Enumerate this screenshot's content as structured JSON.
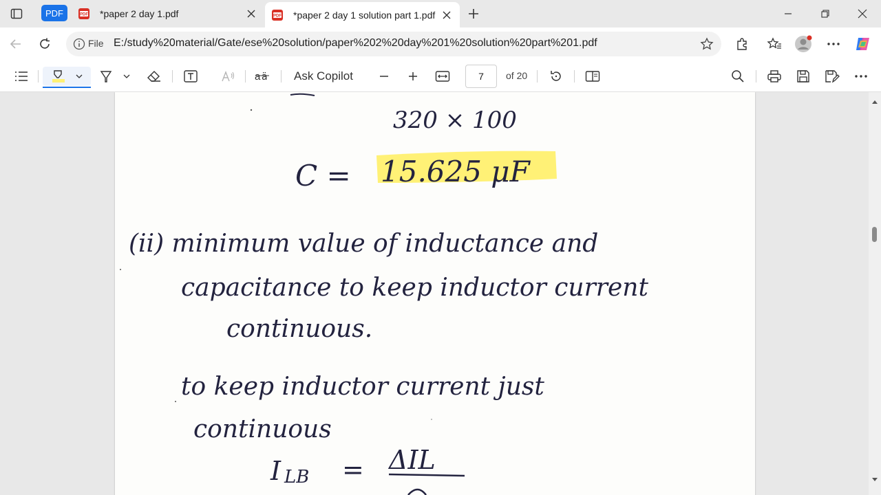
{
  "tabs": {
    "group_label": "PDF",
    "inactive_title": "*paper 2 day 1.pdf",
    "active_title": "*paper 2 day 1 solution part 1.pdf"
  },
  "address": {
    "scheme_label": "File",
    "url": "E:/study%20material/Gate/ese%20solution/paper%202%20day%201%20solution%20part%201.pdf"
  },
  "pdf_toolbar": {
    "ask_copilot": "Ask Copilot",
    "page_current": "7",
    "page_total": "of 20"
  },
  "document": {
    "line1": "320 × 100",
    "line2_lhs": "C =",
    "line2_value": "15.625 μF",
    "line3": "(ii)  minimum value of inductance and",
    "line4": "capacitance to keep inductor current",
    "line5": "continuous.",
    "line6": "to keep inductor current just",
    "line7": "continuous",
    "line8_lhs": "I",
    "line8_sub": "LB",
    "line8_eq": "=",
    "line8_num": "ΔIL"
  },
  "colors": {
    "highlight": "#fff176",
    "accent": "#1a73e8",
    "ink": "#23233f"
  }
}
